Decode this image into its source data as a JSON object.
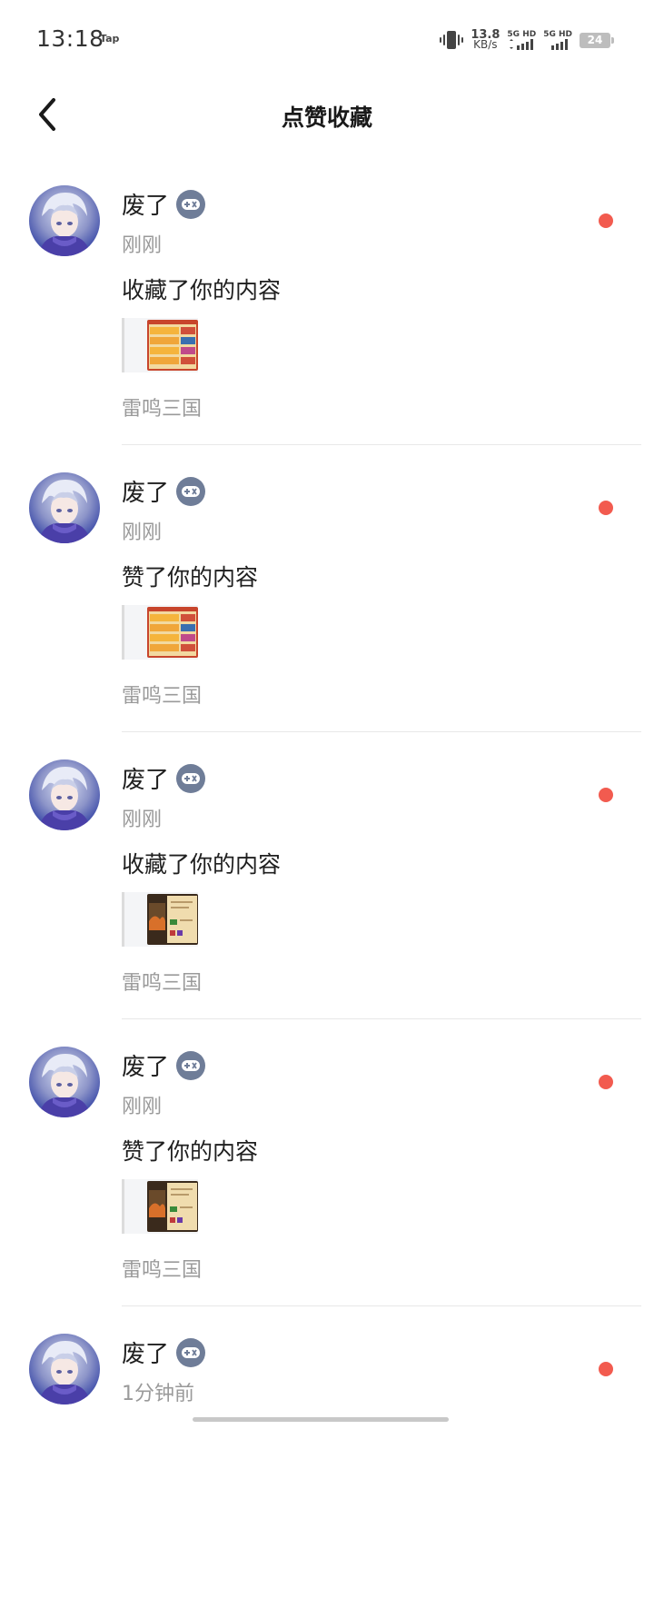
{
  "status_bar": {
    "time": "13:18",
    "tap_label": "Tap",
    "net_speed_value": "13.8",
    "net_speed_unit": "KB/s",
    "sim1_label": "5G HD",
    "sim2_label": "5G HD",
    "battery": "24"
  },
  "header": {
    "title": "点赞收藏"
  },
  "notifications": [
    {
      "user": "废了",
      "time": "刚刚",
      "action": "收藏了你的内容",
      "game": "雷鸣三国",
      "thumb_style": "list",
      "unread": true
    },
    {
      "user": "废了",
      "time": "刚刚",
      "action": "赞了你的内容",
      "game": "雷鸣三国",
      "thumb_style": "list",
      "unread": true
    },
    {
      "user": "废了",
      "time": "刚刚",
      "action": "收藏了你的内容",
      "game": "雷鸣三国",
      "thumb_style": "scene",
      "unread": true
    },
    {
      "user": "废了",
      "time": "刚刚",
      "action": "赞了你的内容",
      "game": "雷鸣三国",
      "thumb_style": "scene",
      "unread": true
    },
    {
      "user": "废了",
      "time": "1分钟前",
      "action": "",
      "game": "",
      "thumb_style": "",
      "unread": true
    }
  ],
  "colors": {
    "unread_dot": "#f25b4f",
    "badge": "#6f7d98",
    "secondary_text": "#9a9a9a"
  }
}
